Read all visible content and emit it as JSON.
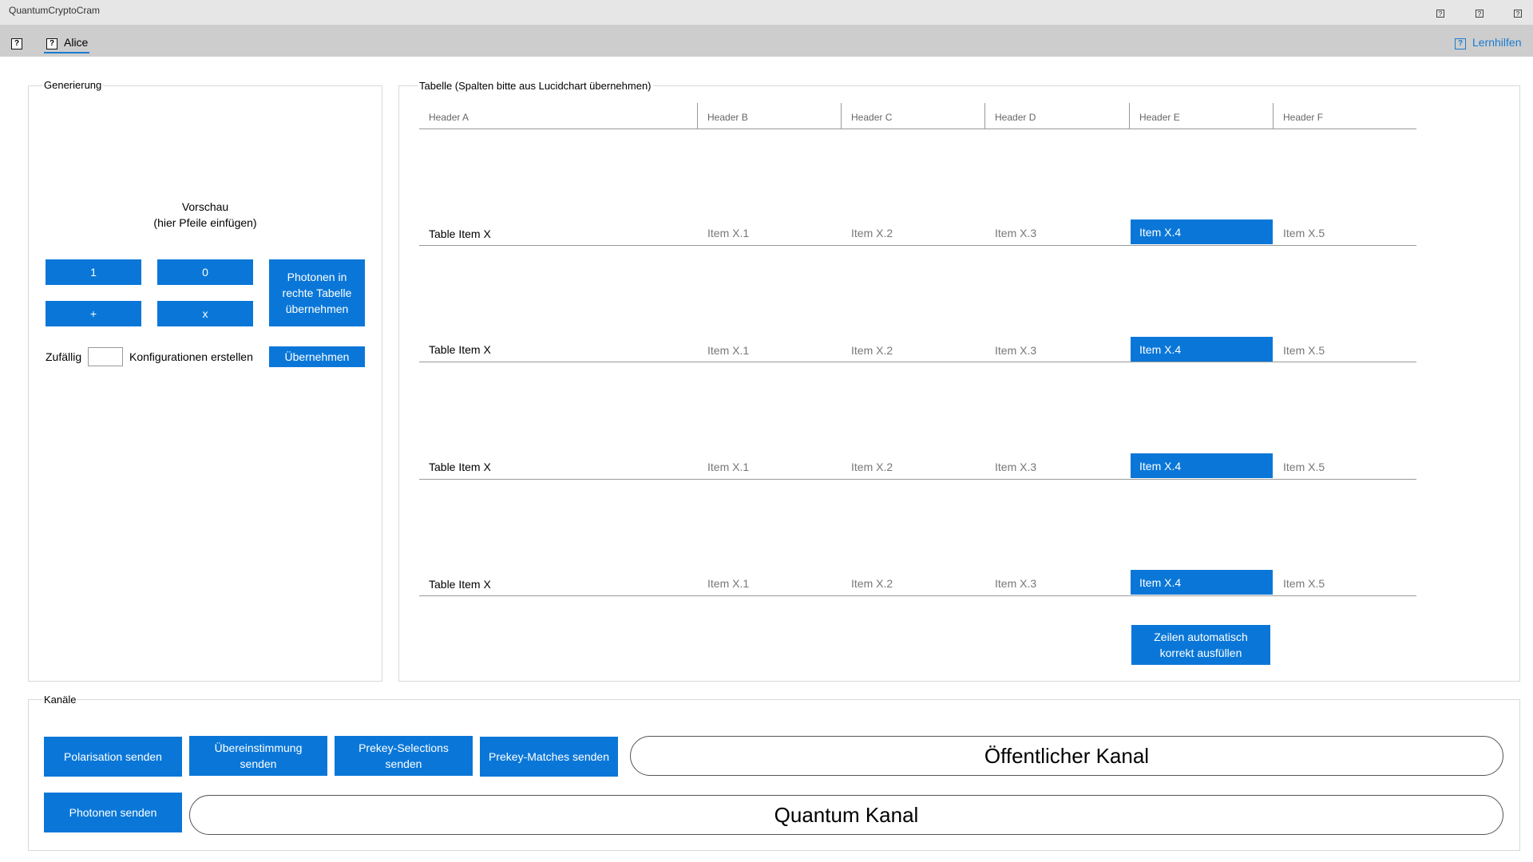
{
  "window": {
    "title": "QuantumCryptoCram",
    "controls": [
      "?",
      "?",
      "?"
    ]
  },
  "tabbar": {
    "menu_icon": "?",
    "active_tab_icon": "?",
    "active_tab": "Alice",
    "help_icon": "?",
    "help_label": "Lernhilfen"
  },
  "generation": {
    "title": "Generierung",
    "preview_line1": "Vorschau",
    "preview_line2": "(hier Pfeile einfügen)",
    "btn_one": "1",
    "btn_zero": "0",
    "btn_plus": "+",
    "btn_x": "x",
    "btn_transfer_photons": "Photonen in rechte Tabelle übernehmen",
    "random_label": "Zufällig",
    "random_value": "",
    "configs_label": "Konfigurationen erstellen",
    "btn_apply": "Übernehmen"
  },
  "table": {
    "title": "Tabelle (Spalten bitte aus Lucidchart übernehmen)",
    "headers": [
      "Header A",
      "Header B",
      "Header C",
      "Header D",
      "Header E",
      "Header F"
    ],
    "rows": [
      [
        "Table Item X",
        "Item X.1",
        "Item X.2",
        "Item X.3",
        "Item X.4",
        "Item X.5"
      ],
      [
        "Table Item X",
        "Item X.1",
        "Item X.2",
        "Item X.3",
        "Item X.4",
        "Item X.5"
      ],
      [
        "Table Item X",
        "Item X.1",
        "Item X.2",
        "Item X.3",
        "Item X.4",
        "Item X.5"
      ],
      [
        "Table Item X",
        "Item X.1",
        "Item X.2",
        "Item X.3",
        "Item X.4",
        "Item X.5"
      ]
    ],
    "highlight_column_index": 4,
    "btn_autofill": "Zeilen automatisch korrekt ausfüllen"
  },
  "channels": {
    "title": "Kanäle",
    "btn_send_polarisation": "Polarisation senden",
    "btn_send_match": "Übereinstimmung senden",
    "btn_send_prekey_selections": "Prekey-Selections senden",
    "btn_send_prekey_matches": "Prekey-Matches senden",
    "btn_send_photons": "Photonen senden",
    "public_channel": "Öffentlicher Kanal",
    "quantum_channel": "Quantum Kanal"
  },
  "colors": {
    "accent": "#0a77d8",
    "titlebar": "#e6e6e6",
    "tabbar": "#cdcdcd"
  }
}
